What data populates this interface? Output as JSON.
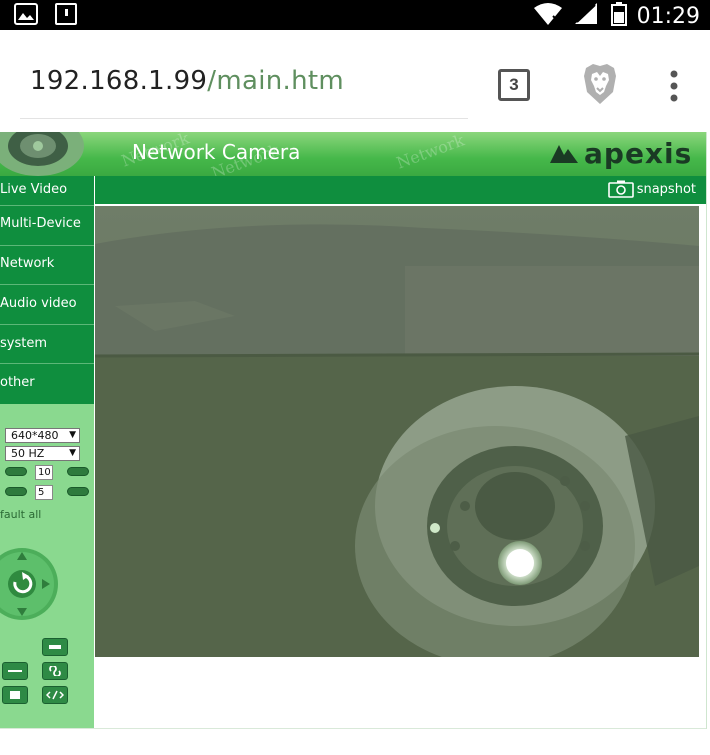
{
  "status_bar": {
    "time": "01:29",
    "left_icons": [
      "image-icon",
      "sd-card-icon"
    ],
    "right_icons": [
      "wifi-icon",
      "signal-icon",
      "battery-icon"
    ]
  },
  "browser": {
    "url_host": "192.168.1.99",
    "url_path": "/main.htm",
    "tab_count": "3",
    "icons": [
      "brave-lion-icon",
      "overflow-menu-icon"
    ]
  },
  "camera_page": {
    "title": "Network Camera",
    "watermark": "Network",
    "brand": "apexis",
    "nav_items": [
      {
        "label": "Live Video"
      },
      {
        "label": "Multi-Device"
      },
      {
        "label": "Network"
      },
      {
        "label": "Audio video"
      },
      {
        "label": "system"
      },
      {
        "label": "other"
      }
    ],
    "snapshot_label": "snapshot",
    "controls": {
      "resolution": "640*480",
      "frequency": "50 HZ",
      "brightness_value": "10",
      "contrast_value": "5",
      "default_label": "fault all"
    }
  },
  "colors": {
    "header_green": "#46b84a",
    "nav_green": "#0f8e3e",
    "control_panel_green": "#8ad98f",
    "url_path_green": "#5f8f5f"
  }
}
